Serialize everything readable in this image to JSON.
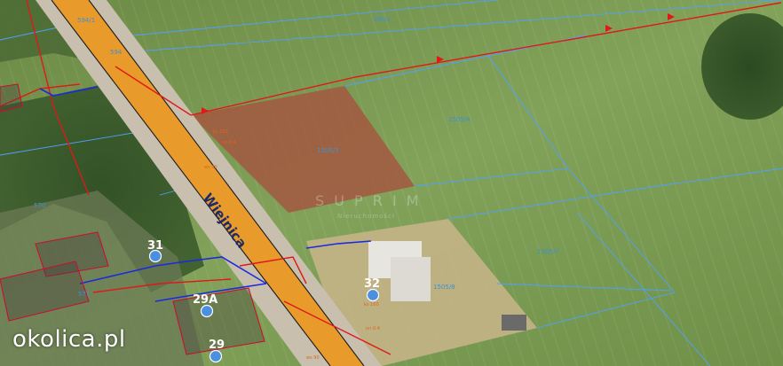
{
  "logo": {
    "text": "okolica.pl"
  },
  "street": {
    "name": "Wiejnica"
  },
  "watermark": {
    "main": "S U P R I M",
    "sub": "Nieruchomości"
  },
  "addresses": [
    {
      "label": "31"
    },
    {
      "label": "32"
    },
    {
      "label": "29A"
    },
    {
      "label": "29"
    }
  ],
  "parcels": [
    {
      "label": "596/1"
    },
    {
      "label": "594/1"
    },
    {
      "label": "594"
    },
    {
      "label": "1505/4"
    },
    {
      "label": "1505/3"
    },
    {
      "label": "1505/7"
    },
    {
      "label": "1505/8"
    },
    {
      "label": "570"
    },
    {
      "label": "571"
    }
  ],
  "colors": {
    "field": "#7a9a55",
    "highlight_parcel": "#a5553f",
    "road": "#e89a2a",
    "road_shoulder": "#c9bfae",
    "parcel_border": "#4fa0ff",
    "power_line": "#e01818",
    "address_marker": "#4a8fe0",
    "building_outline": "#c8102e",
    "gas_line": "#1a2ae0"
  }
}
